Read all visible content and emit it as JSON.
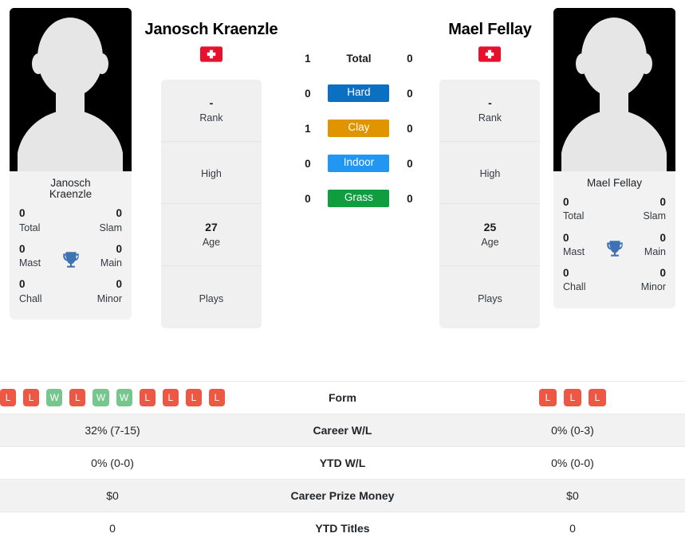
{
  "players": {
    "left": {
      "name": "Janosch Kraenzle",
      "card_name_line1": "Janosch",
      "card_name_line2": "Kraenzle",
      "country_flag": "swiss-flag",
      "photo": "player-silhouette",
      "titles": {
        "total_value": "0",
        "total_label": "Total",
        "slam_value": "0",
        "slam_label": "Slam",
        "mast_value": "0",
        "mast_label": "Mast",
        "main_value": "0",
        "main_label": "Main",
        "chall_value": "0",
        "chall_label": "Chall",
        "minor_value": "0",
        "minor_label": "Minor",
        "trophy_icon": "trophy-icon"
      },
      "info": [
        {
          "value": "-",
          "label": "Rank"
        },
        {
          "value": "",
          "label": "High"
        },
        {
          "value": "27",
          "label": "Age"
        },
        {
          "value": "",
          "label": "Plays"
        }
      ],
      "form": [
        "L",
        "L",
        "W",
        "L",
        "W",
        "W",
        "L",
        "L",
        "L",
        "L"
      ],
      "career_wl": "32% (7-15)",
      "ytd_wl": "0% (0-0)",
      "career_prize_money": "$0",
      "ytd_titles": "0"
    },
    "right": {
      "name": "Mael Fellay",
      "card_name_line1": "Mael Fellay",
      "card_name_line2": "",
      "country_flag": "swiss-flag",
      "photo": "player-silhouette",
      "titles": {
        "total_value": "0",
        "total_label": "Total",
        "slam_value": "0",
        "slam_label": "Slam",
        "mast_value": "0",
        "mast_label": "Mast",
        "main_value": "0",
        "main_label": "Main",
        "chall_value": "0",
        "chall_label": "Chall",
        "minor_value": "0",
        "minor_label": "Minor",
        "trophy_icon": "trophy-icon"
      },
      "info": [
        {
          "value": "-",
          "label": "Rank"
        },
        {
          "value": "",
          "label": "High"
        },
        {
          "value": "25",
          "label": "Age"
        },
        {
          "value": "",
          "label": "Plays"
        }
      ],
      "form": [
        "L",
        "L",
        "L"
      ],
      "career_wl": "0% (0-3)",
      "ytd_wl": "0% (0-0)",
      "career_prize_money": "$0",
      "ytd_titles": "0"
    }
  },
  "head_to_head": [
    {
      "label": "Total",
      "left": "1",
      "right": "0",
      "type": "plain",
      "color": ""
    },
    {
      "label": "Hard",
      "left": "0",
      "right": "0",
      "type": "badge",
      "color": "#0b6fc2"
    },
    {
      "label": "Clay",
      "left": "1",
      "right": "0",
      "type": "badge",
      "color": "#e09400"
    },
    {
      "label": "Indoor",
      "left": "0",
      "right": "0",
      "type": "badge",
      "color": "#2196f3"
    },
    {
      "label": "Grass",
      "left": "0",
      "right": "0",
      "type": "badge",
      "color": "#0f9d3f"
    }
  ],
  "table_rows": [
    {
      "label": "Form",
      "key": "form",
      "type": "form"
    },
    {
      "label": "Career W/L",
      "key": "career_wl",
      "type": "text"
    },
    {
      "label": "YTD W/L",
      "key": "ytd_wl",
      "type": "text"
    },
    {
      "label": "Career Prize Money",
      "key": "career_prize_money",
      "type": "text"
    },
    {
      "label": "YTD Titles",
      "key": "ytd_titles",
      "type": "text"
    }
  ],
  "colors": {
    "win_badge": "#76c78e",
    "loss_badge": "#ef5745",
    "hard": "#0b6fc2",
    "clay": "#e09400",
    "indoor": "#2196f3",
    "grass": "#0f9d3f",
    "flag_red": "#e8112d",
    "trophy_blue": "#3d72b4",
    "card_bg": "#f2f2f2"
  }
}
